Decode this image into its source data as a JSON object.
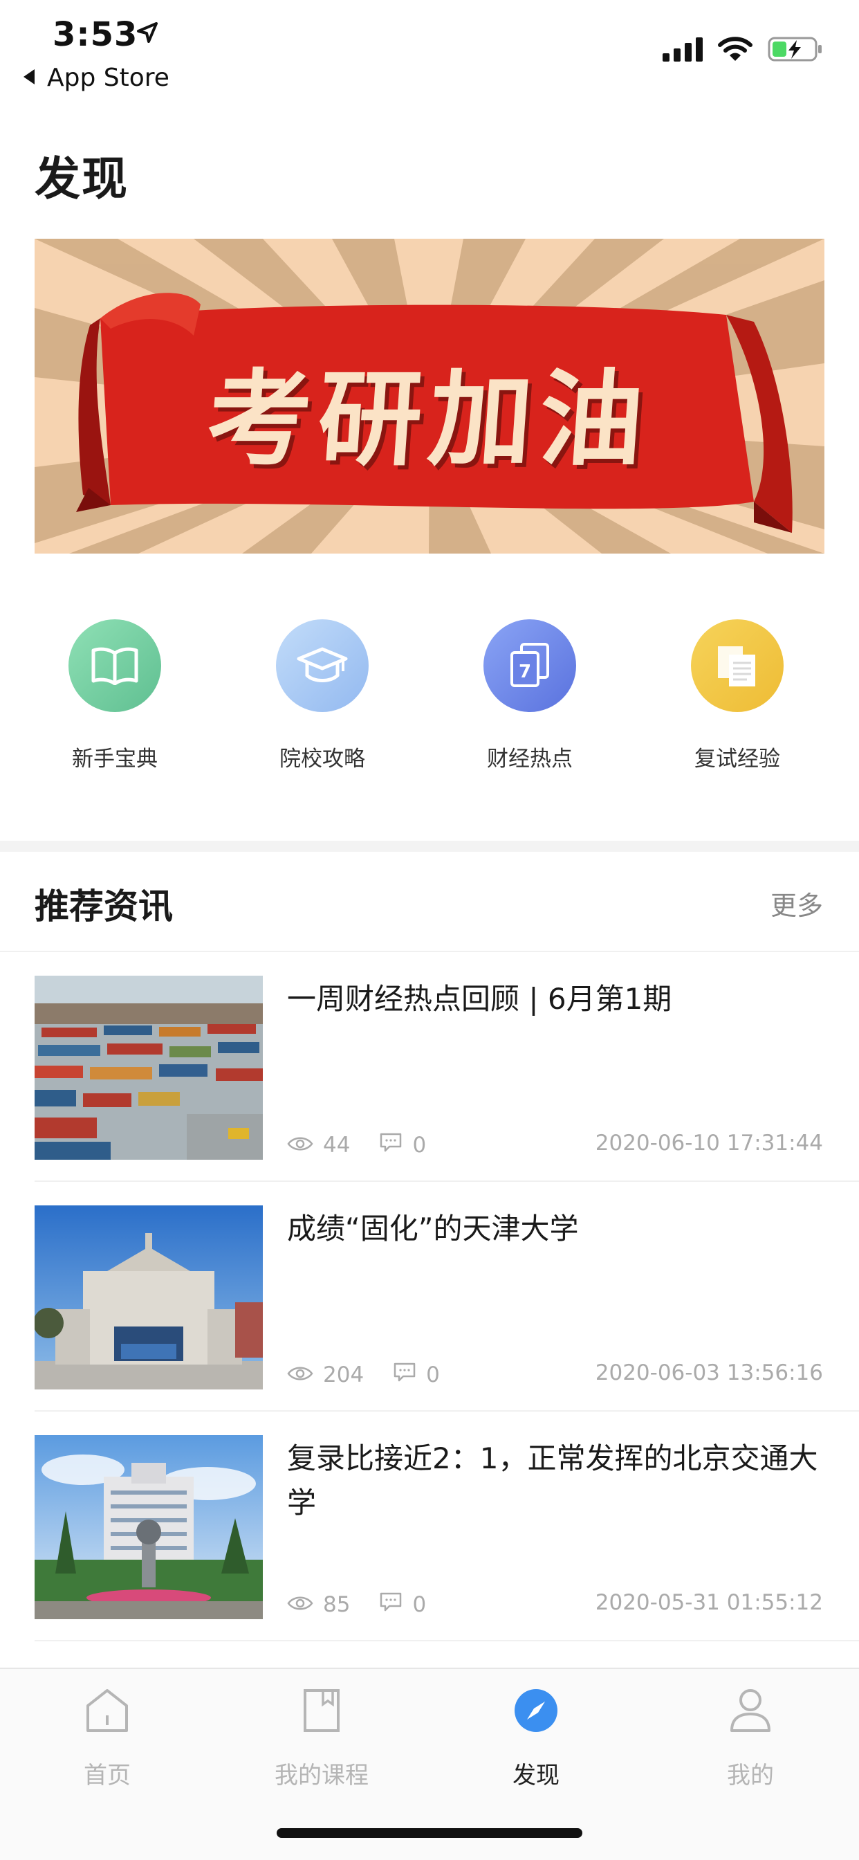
{
  "status_bar": {
    "time": "3:53",
    "back_label": "App Store"
  },
  "page_title": "发现",
  "banner": {
    "text": "考研加油",
    "colors": {
      "ribbon": "#d8231c",
      "text": "#fbe3c6",
      "rays": "#c9a57c",
      "bg": "#f6d3b0"
    }
  },
  "quick_links": [
    {
      "label": "新手宝典",
      "icon": "book-icon",
      "color": "#6fcb9c"
    },
    {
      "label": "院校攻略",
      "icon": "graduation-cap-icon",
      "color": "#a9c9f5"
    },
    {
      "label": "财经热点",
      "icon": "calendar-document-icon",
      "color": "#6d84e8"
    },
    {
      "label": "复试经验",
      "icon": "documents-icon",
      "color": "#f0c84a"
    }
  ],
  "news_section": {
    "title": "推荐资讯",
    "more_label": "更多",
    "items": [
      {
        "title": "一周财经热点回顾 | 6月第1期",
        "views": "44",
        "comments": "0",
        "date": "2020-06-10 17:31:44"
      },
      {
        "title": "成绩“固化”的天津大学",
        "views": "204",
        "comments": "0",
        "date": "2020-06-03 13:56:16"
      },
      {
        "title": "复录比接近2：1，正常发挥的北京交通大学",
        "views": "85",
        "comments": "0",
        "date": "2020-05-31 01:55:12"
      }
    ]
  },
  "tab_bar": {
    "tabs": [
      {
        "label": "首页",
        "icon": "home-icon",
        "active": false
      },
      {
        "label": "我的课程",
        "icon": "bookmark-book-icon",
        "active": false
      },
      {
        "label": "发现",
        "icon": "compass-icon",
        "active": true
      },
      {
        "label": "我的",
        "icon": "user-icon",
        "active": false
      }
    ],
    "accent_color": "#3b8ff0"
  }
}
